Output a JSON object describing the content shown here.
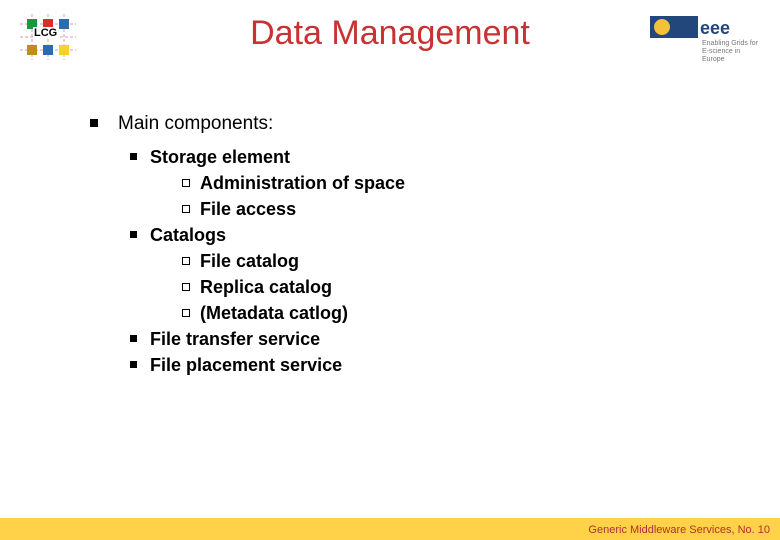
{
  "logos": {
    "lcg_label": "LCG",
    "egee_line1": "Enabling Grids for",
    "egee_line2": "E-science in Europe"
  },
  "title": "Data Management",
  "lvl1_heading": "Main components:",
  "items": {
    "storage_element": "Storage element",
    "storage_sub": {
      "admin": "Administration of space",
      "fileaccess": "File access"
    },
    "catalogs": "Catalogs",
    "catalogs_sub": {
      "file": "File catalog",
      "replica": "Replica catalog",
      "metadata": "(Metadata catlog)"
    },
    "transfer": "File transfer service",
    "placement": "File placement service"
  },
  "footer": "Generic Middleware Services, No. 10"
}
